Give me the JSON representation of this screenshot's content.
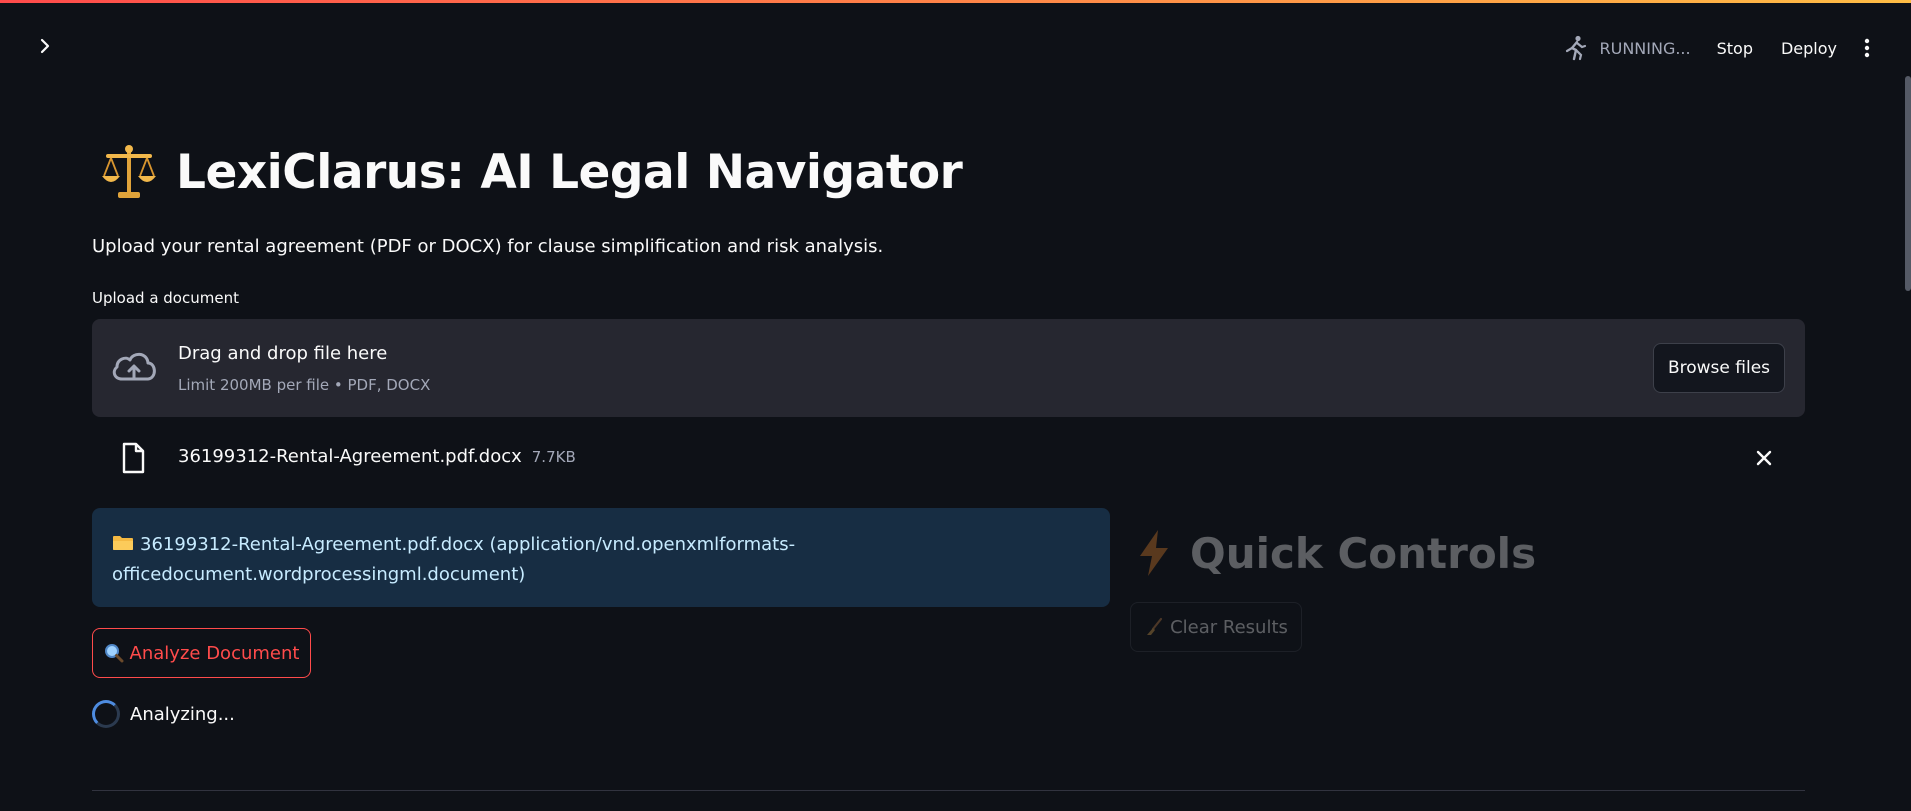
{
  "header": {
    "status_text": "RUNNING...",
    "stop_label": "Stop",
    "deploy_label": "Deploy",
    "icons": {
      "sidebar_toggle": "chevron-right-icon",
      "running": "running-man-icon",
      "menu": "kebab-menu-icon"
    }
  },
  "app": {
    "title": "LexiClarus: AI Legal Navigator",
    "title_icon": "balance-scale-icon",
    "subtitle": "Upload your rental agreement (PDF or DOCX) for clause simplification and risk analysis."
  },
  "uploader": {
    "label": "Upload a document",
    "drag_text": "Drag and drop file here",
    "limit_text": "Limit 200MB per file • PDF, DOCX",
    "browse_label": "Browse files",
    "file": {
      "name": "36199312-Rental-Agreement.pdf.docx",
      "size": "7.7KB"
    }
  },
  "info": {
    "text": "36199312-Rental-Agreement.pdf.docx (application/vnd.openxmlformats-officedocument.wordprocessingml.document)"
  },
  "actions": {
    "analyze_label": "Analyze Document",
    "status_text": "Analyzing..."
  },
  "quick_controls": {
    "title": "Quick Controls",
    "clear_label": "Clear Results"
  },
  "colors": {
    "background": "#0e1117",
    "primary": "#ff4b4b",
    "info_bg": "#172d43",
    "info_text": "#c7ebff",
    "dropzone_bg": "#262730"
  }
}
